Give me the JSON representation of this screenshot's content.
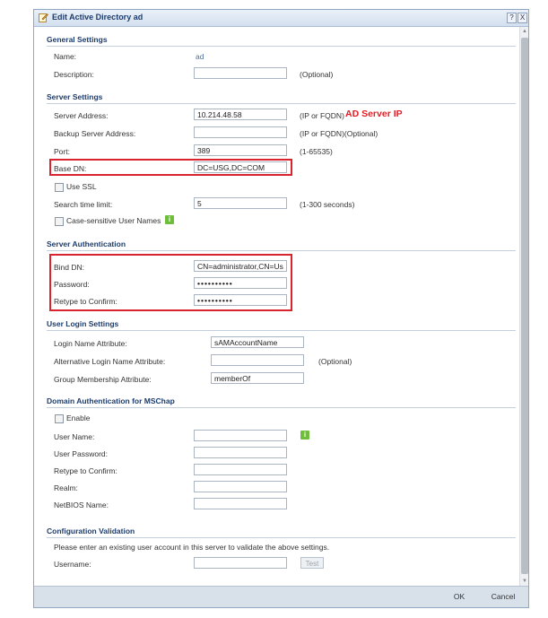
{
  "dialog": {
    "title": "Edit Active Directory ad",
    "help_label": "?",
    "close_label": "X"
  },
  "general": {
    "heading": "General Settings",
    "name_label": "Name:",
    "name_value": "ad",
    "description_label": "Description:",
    "description_value": "",
    "description_hint": "(Optional)"
  },
  "server": {
    "heading": "Server Settings",
    "address_label": "Server Address:",
    "address_value": "10.214.48.58",
    "address_hint": "(IP or FQDN)",
    "address_annotation": "AD Server IP",
    "backup_label": "Backup Server Address:",
    "backup_value": "",
    "backup_hint": "(IP or FQDN)(Optional)",
    "port_label": "Port:",
    "port_value": "389",
    "port_hint": "(1-65535)",
    "basedn_label": "Base DN:",
    "basedn_value": "DC=USG,DC=COM",
    "ssl_label": "Use SSL",
    "timeout_label": "Search time limit:",
    "timeout_value": "5",
    "timeout_hint": "(1-300 seconds)",
    "case_label": "Case-sensitive User Names"
  },
  "auth": {
    "heading": "Server Authentication",
    "binddn_label": "Bind DN:",
    "binddn_value": "CN=administrator,CN=Us",
    "password_label": "Password:",
    "password_value": "••••••••••",
    "retype_label": "Retype to Confirm:",
    "retype_value": "••••••••••"
  },
  "login": {
    "heading": "User Login Settings",
    "name_attr_label": "Login Name Attribute:",
    "name_attr_value": "sAMAccountName",
    "alt_attr_label": "Alternative Login Name Attribute:",
    "alt_attr_value": "",
    "alt_attr_hint": "(Optional)",
    "group_attr_label": "Group Membership Attribute:",
    "group_attr_value": "memberOf"
  },
  "mschap": {
    "heading": "Domain Authentication for MSChap",
    "enable_label": "Enable",
    "user_label": "User Name:",
    "password_label": "User Password:",
    "retype_label": "Retype to Confirm:",
    "realm_label": "Realm:",
    "netbios_label": "NetBIOS Name:"
  },
  "validation": {
    "heading": "Configuration Validation",
    "instruction": "Please enter an existing user account in this server to validate the above settings.",
    "username_label": "Username:",
    "test_label": "Test"
  },
  "footer": {
    "ok_label": "OK",
    "cancel_label": "Cancel"
  },
  "colors": {
    "annotation_red": "#e51b24",
    "heading_blue": "#1d3c6b",
    "info_green": "#6fbe3b"
  }
}
